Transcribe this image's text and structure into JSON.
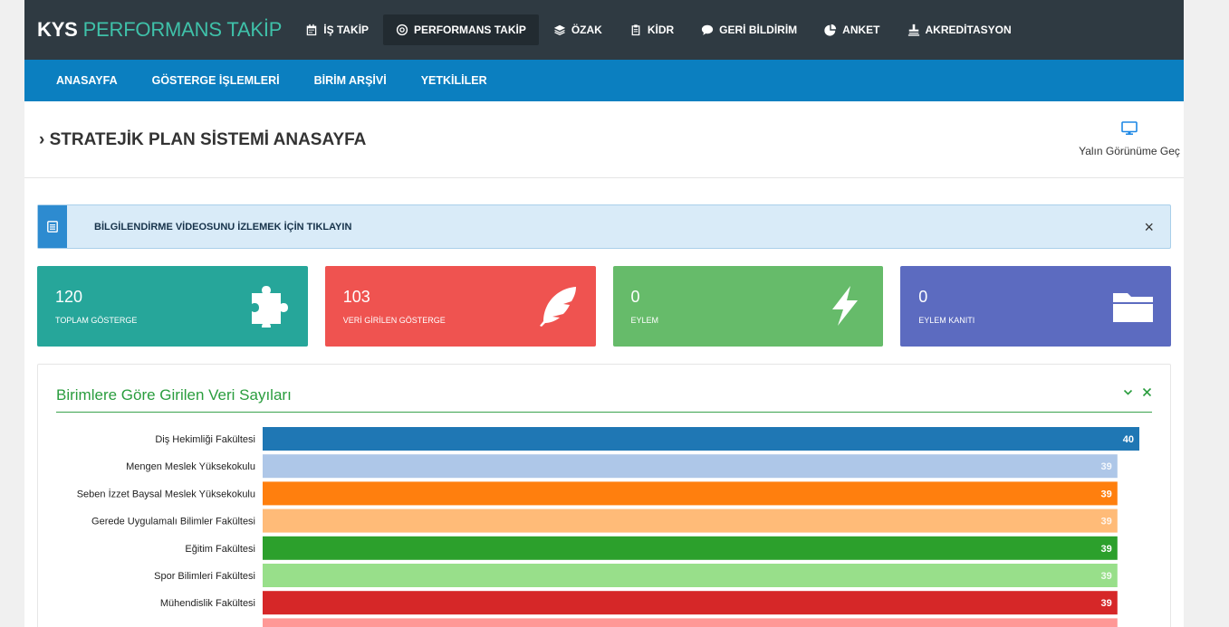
{
  "topbar": {
    "brand_main": "KYS",
    "brand_accent": "PERFORMANS TAKİP",
    "items": [
      {
        "label": "İŞ TAKİP",
        "icon": "calendar-icon"
      },
      {
        "label": "PERFORMANS TAKİP",
        "icon": "target-icon",
        "active": true
      },
      {
        "label": "ÖZAK",
        "icon": "layers-icon"
      },
      {
        "label": "KİDR",
        "icon": "clipboard-icon"
      },
      {
        "label": "GERİ BİLDİRİM",
        "icon": "comment-icon"
      },
      {
        "label": "ANKET",
        "icon": "pie-chart-icon"
      },
      {
        "label": "AKREDİTASYON",
        "icon": "stamp-icon"
      }
    ]
  },
  "subnav": {
    "items": [
      {
        "label": "ANASAYFA"
      },
      {
        "label": "GÖSTERGE İŞLEMLERİ"
      },
      {
        "label": "BİRİM ARŞİVİ"
      },
      {
        "label": "YETKİLİLER"
      }
    ]
  },
  "page": {
    "title": "STRATEJİK PLAN SİSTEMİ ANASAYFA",
    "simple_view_label": "Yalın Görünüme Geç",
    "simple_view_icon": "monitor-icon"
  },
  "alert": {
    "text": "BİLGİLENDİRME VİDEOSUNU İZLEMEK İÇİN TIKLAYIN",
    "icon": "document-icon",
    "close": "×"
  },
  "stats": [
    {
      "value": "120",
      "label": "TOPLAM GÖSTERGE",
      "color": "#26a69a",
      "icon": "puzzle-icon"
    },
    {
      "value": "103",
      "label": "VERİ GİRİLEN GÖSTERGE",
      "color": "#ef5350",
      "icon": "feather-icon"
    },
    {
      "value": "0",
      "label": "EYLEM",
      "color": "#66bb6a",
      "icon": "bolt-icon"
    },
    {
      "value": "0",
      "label": "EYLEM KANITI",
      "color": "#5c6bc0",
      "icon": "folder-icon"
    }
  ],
  "panel": {
    "title": "Birimlere Göre Girilen Veri Sayıları",
    "collapse_icon": "chevron-down-icon",
    "close_icon": "close-icon"
  },
  "chart_data": {
    "type": "bar",
    "orientation": "horizontal",
    "categories": [
      "Diş Hekimliği Fakültesi",
      "Mengen Meslek Yüksekokulu",
      "Seben İzzet Baysal Meslek Yüksekokulu",
      "Gerede Uygulamalı Bilimler Fakültesi",
      "Eğitim Fakültesi",
      "Spor Bilimleri Fakültesi",
      "Mühendislik Fakültesi",
      ""
    ],
    "values": [
      40,
      39,
      39,
      39,
      39,
      39,
      39,
      null
    ],
    "colors": [
      "#1f77b4",
      "#aec7e8",
      "#ff7f0e",
      "#ffbb78",
      "#2ca02c",
      "#98df8a",
      "#d62728",
      "#ff9896"
    ],
    "xlim": [
      0,
      40
    ],
    "title": "",
    "xlabel": "",
    "ylabel": ""
  }
}
